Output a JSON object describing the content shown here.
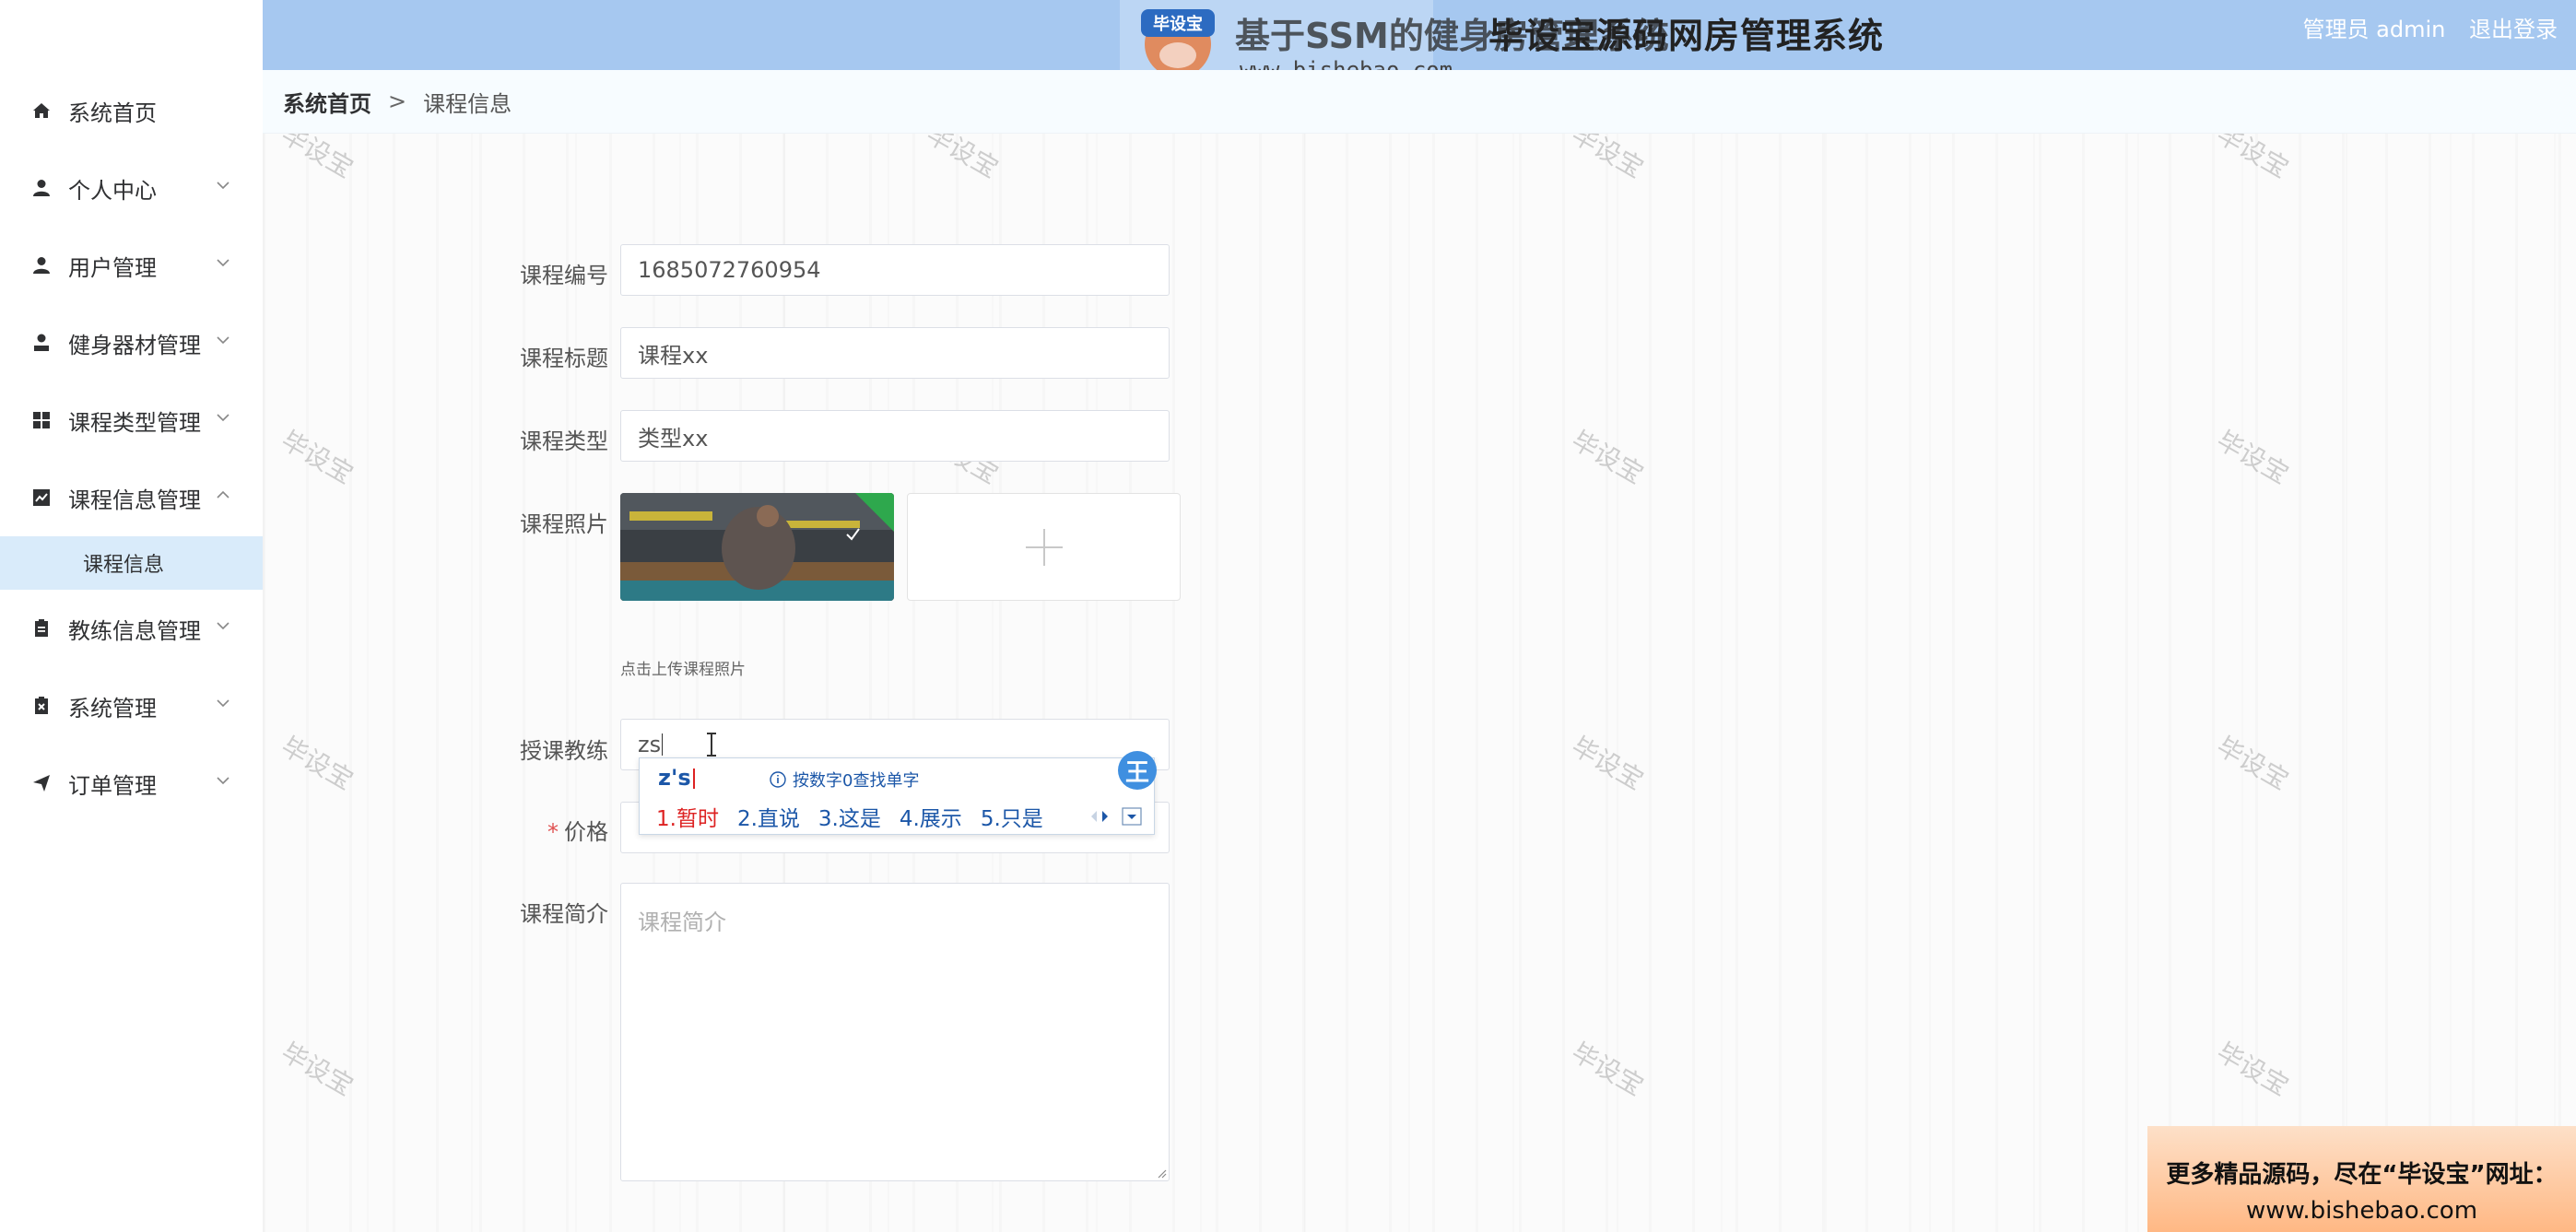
{
  "header": {
    "logo_badge": "毕设宝",
    "logo_watermark_text": "基于SSM的健身房管理系统",
    "title": "毕设宝源码网",
    "title_suffix": "房管理系统",
    "url": "www.bishebao.com",
    "user_label": "管理员 admin",
    "logout_label": "退出登录"
  },
  "sidebar": {
    "items": [
      {
        "label": "系统首页",
        "icon": "home-icon"
      },
      {
        "label": "个人中心",
        "icon": "user-icon"
      },
      {
        "label": "用户管理",
        "icon": "user-icon"
      },
      {
        "label": "健身器材管理",
        "icon": "user-icon"
      },
      {
        "label": "课程类型管理",
        "icon": "grid-icon"
      },
      {
        "label": "课程信息管理",
        "icon": "chart-icon"
      },
      {
        "label": "教练信息管理",
        "icon": "clipboard-icon"
      },
      {
        "label": "系统管理",
        "icon": "clipboard-x-icon"
      },
      {
        "label": "订单管理",
        "icon": "send-icon"
      }
    ],
    "subitem": "课程信息"
  },
  "breadcrumb": {
    "home": "系统首页",
    "separator": ">",
    "current": "课程信息"
  },
  "watermark": "毕设宝",
  "form": {
    "course_no_label": "课程编号",
    "course_no_value": "1685072760954",
    "course_title_label": "课程标题",
    "course_title_value": "课程xx",
    "course_type_label": "课程类型",
    "course_type_value": "类型xx",
    "course_photo_label": "课程照片",
    "upload_tip": "点击上传课程照片",
    "coach_label": "授课教练",
    "coach_value": "zs",
    "price_label": "价格",
    "price_required": "*",
    "intro_label": "课程简介",
    "intro_placeholder": "课程简介"
  },
  "ime": {
    "composition": "z's",
    "hint": "按数字0查找单字",
    "candidates": [
      "1.暂时",
      "2.直说",
      "3.这是",
      "4.展示",
      "5.只是"
    ],
    "logo": "王"
  },
  "promo": {
    "line1": "更多精品源码，尽在“毕设宝”网址：",
    "line2": "www.bishebao.com"
  },
  "colors": {
    "header_bg": "#a6c8f0",
    "submenu_active": "#d9ebfa",
    "ime_blue": "#1c57a8"
  }
}
